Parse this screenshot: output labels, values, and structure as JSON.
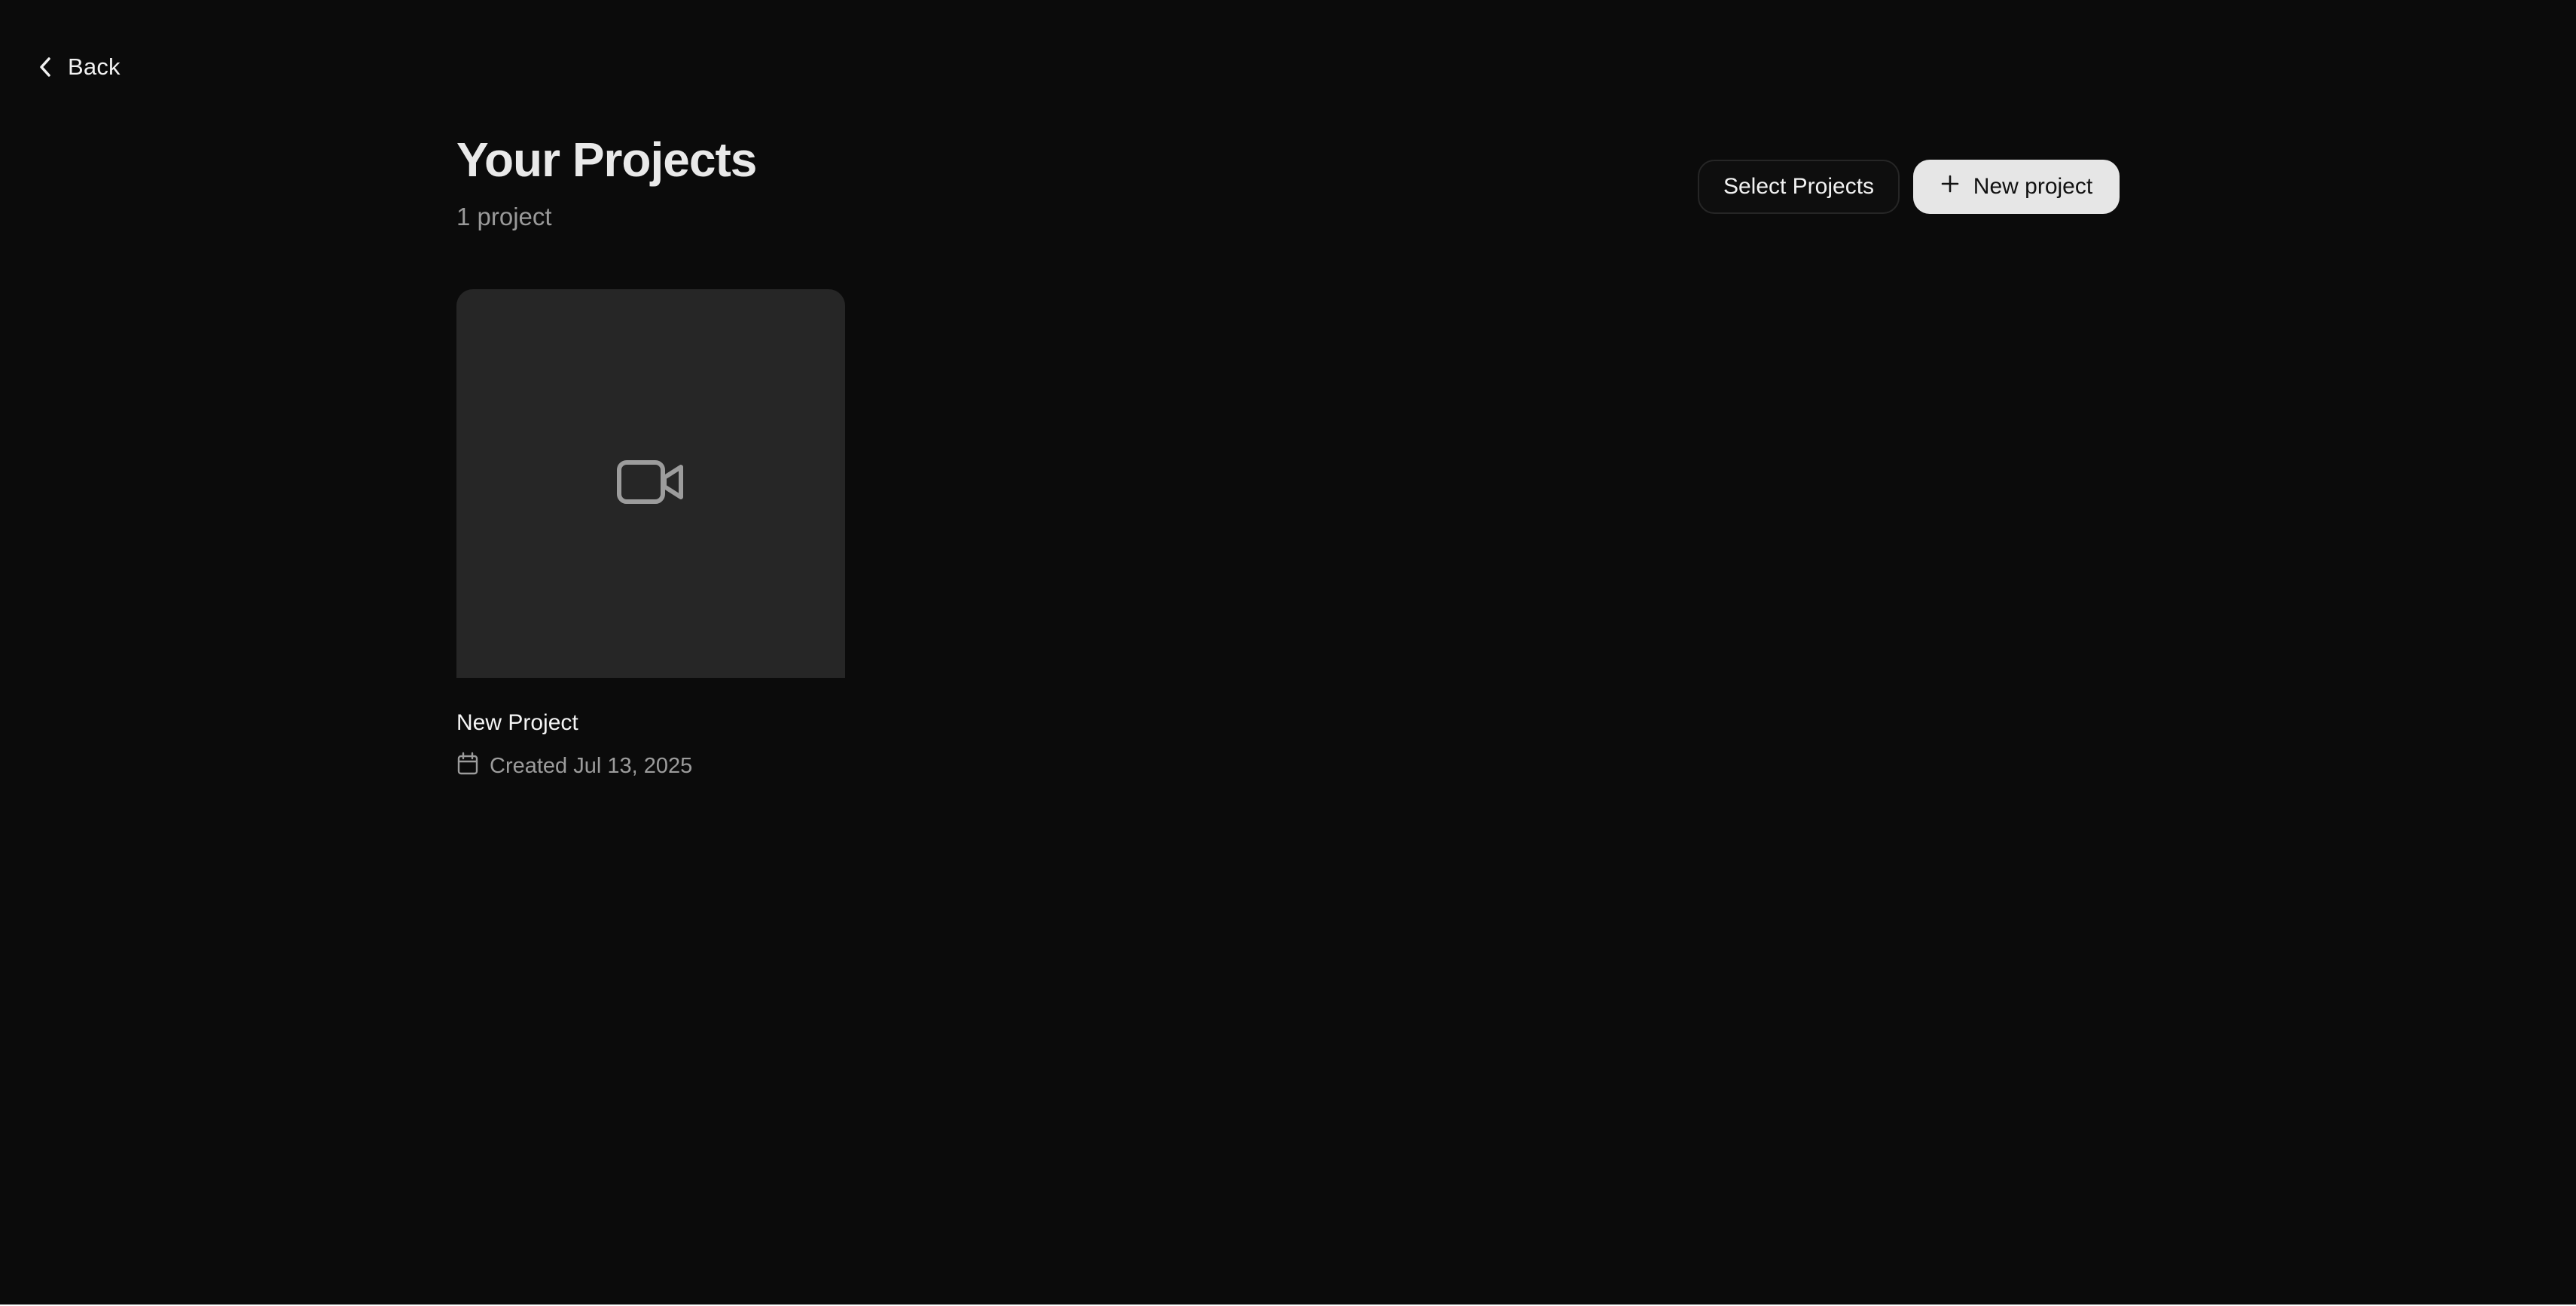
{
  "nav": {
    "back_label": "Back"
  },
  "header": {
    "title": "Your Projects",
    "count": "1 project"
  },
  "actions": {
    "select_label": "Select Projects",
    "new_label": "New project"
  },
  "projects": [
    {
      "title": "New Project",
      "created": "Created Jul 13, 2025",
      "thumbnail_icon": "video-camera-icon"
    }
  ],
  "icons": {
    "back": "chevron-left-icon",
    "new": "plus-icon",
    "date": "calendar-icon"
  },
  "colors": {
    "background": "#0b0b0b",
    "card_thumbnail": "#262626",
    "primary_button": "#e6e6e6",
    "muted_text": "#9a9a9a"
  }
}
